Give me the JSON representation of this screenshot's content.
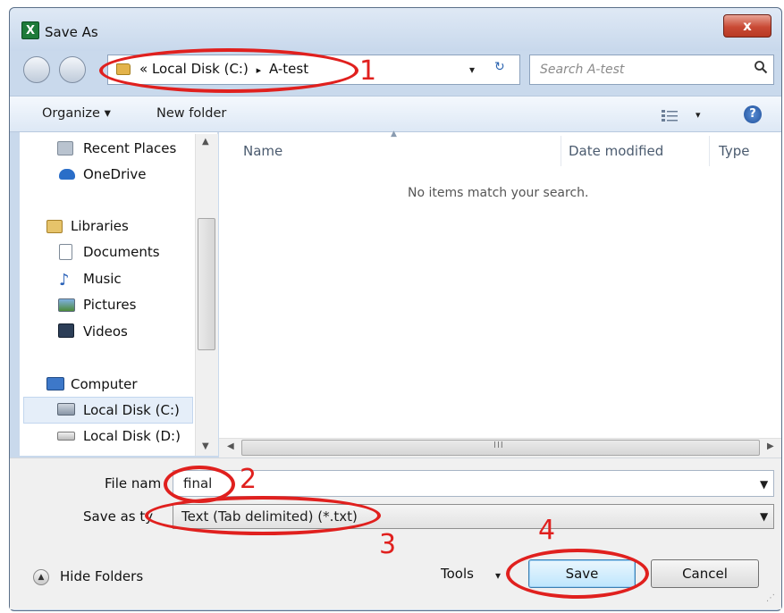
{
  "window": {
    "title": "Save As",
    "close_label": "x",
    "app_icon": "excel-icon"
  },
  "address": {
    "crumbs_prefix": "«",
    "crumb1": "Local Disk (C:)",
    "separator": "▸",
    "crumb2": "A-test",
    "dropdown": "▾",
    "refresh": "↻"
  },
  "search": {
    "placeholder": "Search A-test",
    "icon": "search-icon"
  },
  "toolbar": {
    "organize": "Organize ▾",
    "new_folder": "New folder",
    "view_arrow": "▾",
    "help": "?"
  },
  "nav": {
    "items": [
      {
        "label": "Recent Places",
        "icon": "recent-places-icon"
      },
      {
        "label": "OneDrive",
        "icon": "onedrive-icon"
      },
      {
        "label": "Libraries",
        "icon": "libraries-icon"
      },
      {
        "label": "Documents",
        "icon": "documents-icon"
      },
      {
        "label": "Music",
        "icon": "music-icon"
      },
      {
        "label": "Pictures",
        "icon": "pictures-icon"
      },
      {
        "label": "Videos",
        "icon": "videos-icon"
      },
      {
        "label": "Computer",
        "icon": "computer-icon"
      },
      {
        "label": "Local Disk (C:)",
        "icon": "drive-c-icon"
      },
      {
        "label": "Local Disk (D:)",
        "icon": "drive-d-icon"
      }
    ]
  },
  "files": {
    "columns": [
      "Name",
      "Date modified",
      "Type"
    ],
    "empty_message": "No items match your search.",
    "scroll_grip": "III"
  },
  "form": {
    "file_name_label": "File nam",
    "file_name_value": "final",
    "save_type_label": "Save as ty",
    "save_type_value": "Text (Tab delimited) (*.txt)"
  },
  "footer": {
    "hide_folders": "Hide Folders",
    "tools": "Tools",
    "tools_arrow": "▾",
    "save": "Save",
    "cancel": "Cancel"
  },
  "annotations": {
    "n1": "1",
    "n2": "2",
    "n3": "3",
    "n4": "4",
    "color": "#e0201e"
  }
}
